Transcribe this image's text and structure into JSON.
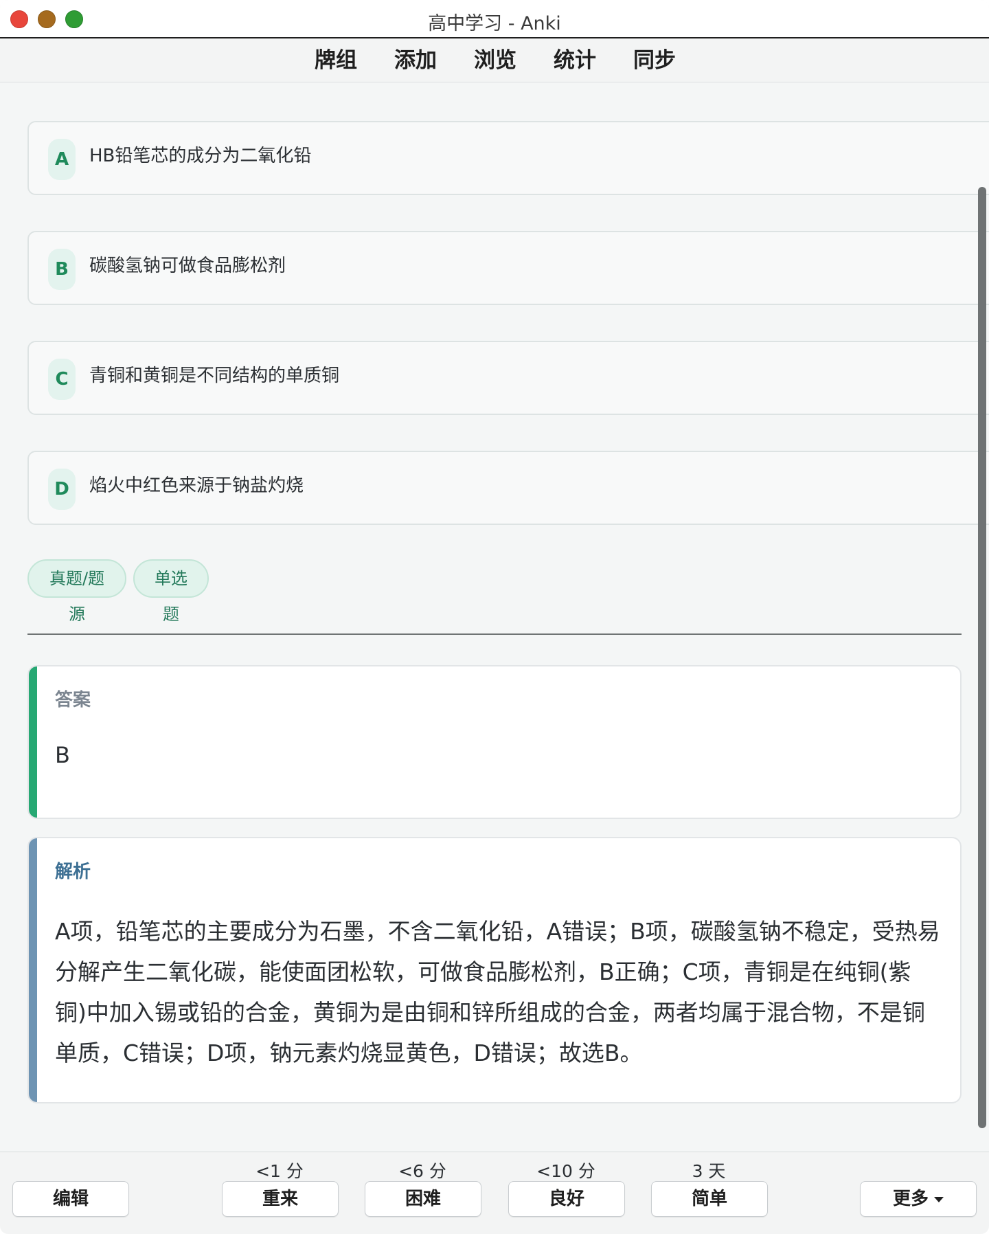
{
  "window": {
    "title": "高中学习 - Anki"
  },
  "toolbar": {
    "items": [
      {
        "label": "牌组"
      },
      {
        "label": "添加"
      },
      {
        "label": "浏览"
      },
      {
        "label": "统计"
      },
      {
        "label": "同步"
      }
    ]
  },
  "card": {
    "options": [
      {
        "letter": "A",
        "text": "HB铅笔芯的成分为二氧化铅"
      },
      {
        "letter": "B",
        "text": "碳酸氢钠可做食品膨松剂"
      },
      {
        "letter": "C",
        "text": "青铜和黄铜是不同结构的单质铜"
      },
      {
        "letter": "D",
        "text": "焰火中红色来源于钠盐灼烧"
      }
    ],
    "tags": [
      {
        "label": "真题/题源"
      },
      {
        "label": "单选题"
      }
    ],
    "answer": {
      "label": "答案",
      "value": "B"
    },
    "explanation": {
      "label": "解析",
      "text": "A项，铅笔芯的主要成分为石墨，不含二氧化铅，A错误；B项，碳酸氢钠不稳定，受热易分解产生二氧化碳，能使面团松软，可做食品膨松剂，B正确；C项，青铜是在纯铜(紫铜)中加入锡或铅的合金，黄铜为是由铜和锌所组成的合金，两者均属于混合物，不是铜单质，C错误；D项，钠元素灼烧显黄色，D错误；故选B。"
    }
  },
  "bottom": {
    "edit_label": "编辑",
    "more_label": "更多",
    "answers": [
      {
        "label": "重来",
        "interval": "<1 分"
      },
      {
        "label": "困难",
        "interval": "<6 分"
      },
      {
        "label": "良好",
        "interval": "<10 分"
      },
      {
        "label": "简单",
        "interval": "3 天"
      }
    ]
  },
  "icons": {
    "close": "red-traffic-light",
    "minimize": "yellow-traffic-light",
    "maximize": "green-traffic-light",
    "more_chevron": "chevron-down-icon"
  },
  "colors": {
    "accent_green": "#27a873",
    "accent_blue": "#6e94b3",
    "tag_bg": "#e1f3ec"
  }
}
